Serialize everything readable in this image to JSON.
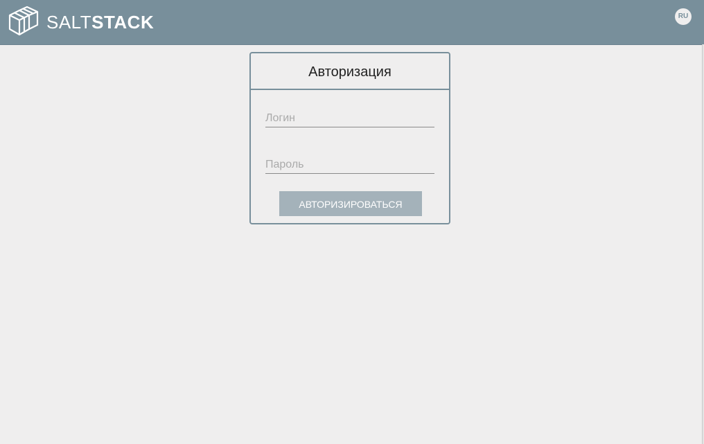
{
  "header": {
    "logo_light": "SALT",
    "logo_bold": "STACK",
    "logo_icon": "saltstack-cube-icon",
    "language_button": "RU",
    "background_color": "#788f9b"
  },
  "login": {
    "title": "Авторизация",
    "login_placeholder": "Логин",
    "password_placeholder": "Пароль",
    "submit_label": "АВТОРИЗИРОВАТЬСЯ",
    "border_color": "#788f9b",
    "button_color": "#a4b2ba"
  }
}
